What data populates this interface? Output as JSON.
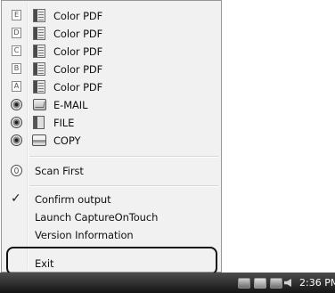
{
  "menu": {
    "job_items": [
      {
        "letter": "E",
        "label": "Color PDF"
      },
      {
        "letter": "D",
        "label": "Color PDF"
      },
      {
        "letter": "C",
        "label": "Color PDF"
      },
      {
        "letter": "B",
        "label": "Color PDF"
      },
      {
        "letter": "A",
        "label": "Color PDF"
      }
    ],
    "share_items": [
      {
        "icon": "email-icon",
        "label": "E-MAIL"
      },
      {
        "icon": "file-icon",
        "label": "FILE"
      },
      {
        "icon": "copy-icon",
        "label": "COPY"
      }
    ],
    "scan_first": "Scan First",
    "confirm_output": "Confirm output",
    "confirm_output_checked": true,
    "launch": "Launch CaptureOnTouch",
    "version": "Version Information",
    "exit": "Exit"
  },
  "taskbar": {
    "clock": "2:36 PM"
  }
}
